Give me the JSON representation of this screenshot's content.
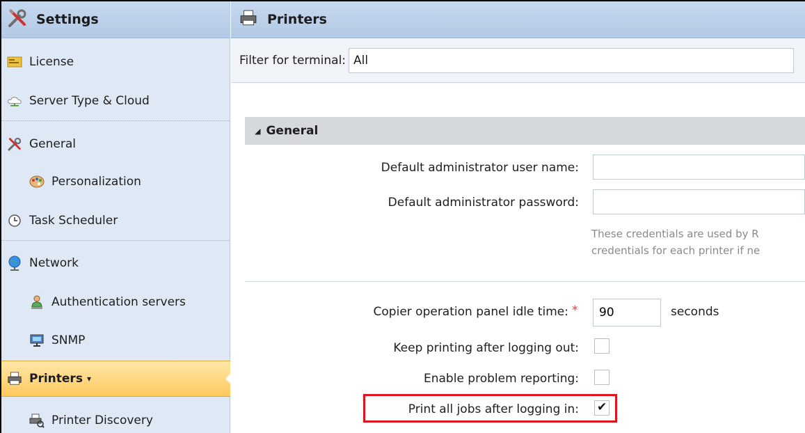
{
  "sidebar": {
    "title": "Settings",
    "items": [
      {
        "label": "License"
      },
      {
        "label": "Server Type & Cloud"
      },
      {
        "label": "General"
      },
      {
        "label": "Personalization"
      },
      {
        "label": "Task Scheduler"
      },
      {
        "label": "Network"
      },
      {
        "label": "Authentication servers"
      },
      {
        "label": "SNMP"
      },
      {
        "label": "Printers",
        "caret": "▾"
      },
      {
        "label": "Printer Discovery"
      }
    ]
  },
  "main": {
    "title": "Printers",
    "filter": {
      "label": "Filter for terminal:",
      "value": "All"
    },
    "group": {
      "toggle": "◢",
      "title": "General"
    },
    "fields": {
      "admin_user_label": "Default administrator user name:",
      "admin_user_value": "",
      "admin_pass_label": "Default administrator password:",
      "admin_pass_value": "",
      "note_line1": "These credentials are used by R",
      "note_line2": "credentials for each printer if ne",
      "idle_label": "Copier operation panel idle time:",
      "idle_required": "*",
      "idle_value": "90",
      "idle_unit": "seconds",
      "keep_printing_label": "Keep printing after logging out:",
      "keep_printing_checked": false,
      "problem_report_label": "Enable problem reporting:",
      "problem_report_checked": false,
      "print_all_label": "Print all jobs after logging in:",
      "print_all_checked": true
    }
  },
  "colors": {
    "sidebar_bg": "#dfe9f5",
    "header_bg": "#b3c9e5",
    "active_item": "#ffc95e",
    "highlight_border": "#e0141e",
    "required": "#e23b3b"
  }
}
